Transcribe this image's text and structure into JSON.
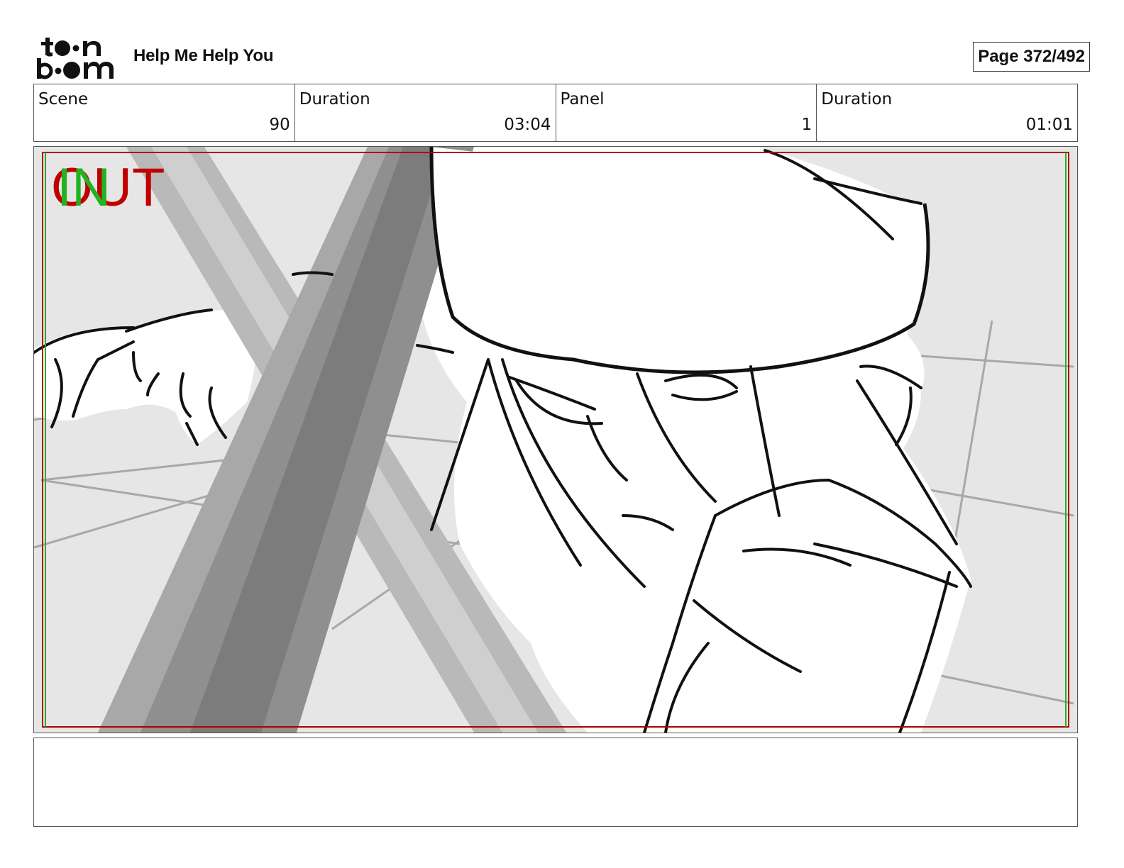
{
  "header": {
    "logo_text": "toon boom",
    "project_title": "Help Me Help You",
    "page_label": "Page 372/492"
  },
  "info": [
    {
      "label": "Scene",
      "value": "90"
    },
    {
      "label": "Duration",
      "value": "03:04"
    },
    {
      "label": "Panel",
      "value": "1"
    },
    {
      "label": "Duration",
      "value": "01:01"
    }
  ],
  "panel": {
    "in_label": "IN",
    "out_label": "OUT",
    "colors": {
      "out": "#c00000",
      "in": "#22b222",
      "safe_frame": "#b00000"
    }
  },
  "caption": {
    "text": ""
  }
}
